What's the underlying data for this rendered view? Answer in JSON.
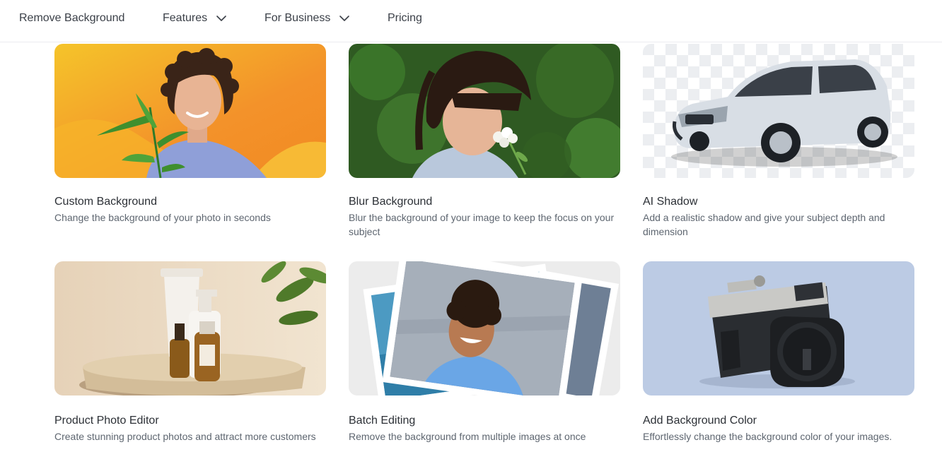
{
  "nav": {
    "items": [
      {
        "label": "Remove Background",
        "has_dropdown": false
      },
      {
        "label": "Features",
        "has_dropdown": true
      },
      {
        "label": "For Business",
        "has_dropdown": true
      },
      {
        "label": "Pricing",
        "has_dropdown": false
      }
    ],
    "dropdown_icon": "chevron-down-icon"
  },
  "cards": [
    {
      "title": "Custom Background",
      "description": "Change the background of your photo in seconds",
      "image": "man-with-plant-on-orange-background"
    },
    {
      "title": "Blur Background",
      "description": "Blur the background of your image to keep the focus on your subject",
      "image": "girl-smelling-flower-blurred-green"
    },
    {
      "title": "AI Shadow",
      "description": "Add a realistic shadow and give your subject depth and dimension",
      "image": "white-suv-on-transparent-checkerboard"
    },
    {
      "title": "Product Photo Editor",
      "description": "Create stunning product photos and attract more customers",
      "image": "cosmetic-bottles-on-stone-pedestal"
    },
    {
      "title": "Batch Editing",
      "description": "Remove the background from multiple images at once",
      "image": "stack-of-photos-smiling-man"
    },
    {
      "title": "Add Background Color",
      "description": "Effortlessly change the background color of your images.",
      "image": "camera-on-light-blue-background"
    }
  ],
  "colors": {
    "text_primary": "#2c3036",
    "text_secondary": "#5e6670",
    "nav_text": "#3a3f47"
  }
}
